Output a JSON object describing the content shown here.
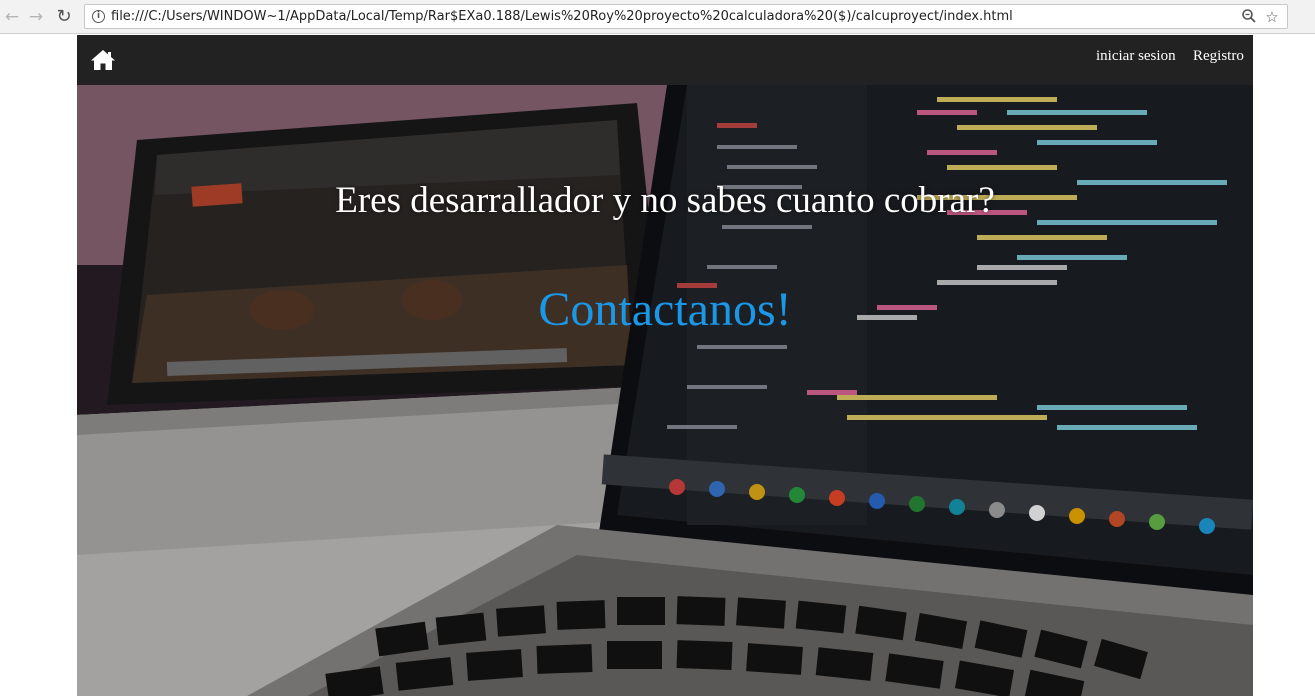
{
  "browser": {
    "url": "file:///C:/Users/WINDOW~1/AppData/Local/Temp/Rar$EXa0.188/Lewis%20Roy%20proyecto%20calculadora%20($)/calcuproyect/index.html",
    "back_icon": "arrow-left-icon",
    "forward_icon": "arrow-right-icon",
    "reload_icon": "reload-icon",
    "zoom_icon": "magnifier-icon",
    "bookmark_icon": "star-icon"
  },
  "navbar": {
    "home_icon": "home-icon",
    "links": [
      {
        "label": "iniciar sesion"
      },
      {
        "label": "Registro"
      }
    ]
  },
  "hero": {
    "title": "Eres desarrallador y no sabes cuanto cobrar?",
    "cta": "Contactanos!",
    "cta_color": "#1b97e8"
  }
}
